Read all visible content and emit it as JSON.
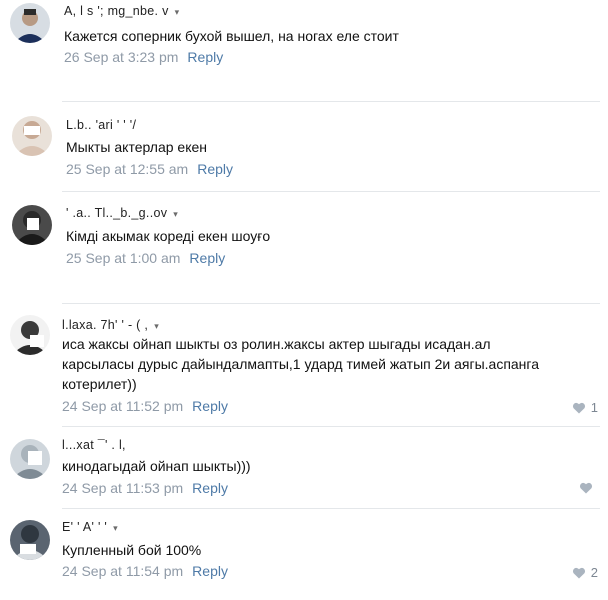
{
  "comments": [
    {
      "author": "A, l s '; mg_nbe. v",
      "text": "Кажется соперник бухой вышел, на ногах еле стоит",
      "date": "26 Sep at 3:23 pm",
      "reply": "Reply",
      "likes": ""
    },
    {
      "author": "L.b.. 'ari '  '  '/",
      "text": "Мыкты актерлар екен",
      "date": "25 Sep at 12:55 am",
      "reply": "Reply",
      "likes": ""
    },
    {
      "author": "' .a.. Tl.._b._g..ov",
      "text": "Кімді акымак кореді екен шоуғо",
      "date": "25 Sep at 1:00 am",
      "reply": "Reply",
      "likes": ""
    },
    {
      "author": "l.laxa. 7h' ' -  ( ,",
      "text_lines": [
        "иса жаксы ойнап шыкты оз ролин.жаксы актер шыгады исадан.ал",
        "карсыласы дурыс дайындалмапты,1 удард тимей жатып 2и аягы.аспанга",
        "котерилет))"
      ],
      "date": "24 Sep at 11:52 pm",
      "reply": "Reply",
      "likes": "1"
    },
    {
      "author": "l...xat ¯' . l,",
      "text": "кинодагыдай ойнап шыкты)))",
      "date": "24 Sep at 11:53 pm",
      "reply": "Reply",
      "likes": ""
    },
    {
      "author": "E' ' A' ' '",
      "text": "Купленный бой 100%",
      "date": "24 Sep at 11:54 pm",
      "reply": "Reply",
      "likes": "2"
    }
  ]
}
